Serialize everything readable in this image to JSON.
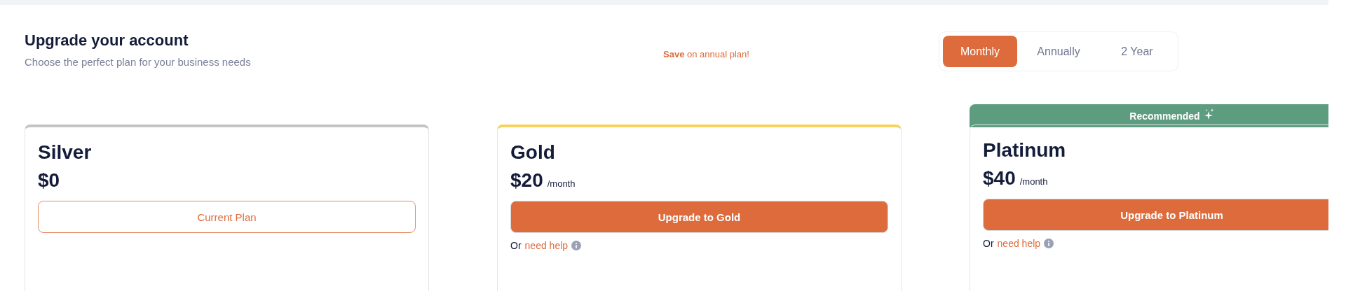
{
  "header": {
    "title": "Upgrade your account",
    "subtitle": "Choose the perfect plan for your business needs"
  },
  "promo": "**Save** on annual plan!",
  "billing_tabs": [
    {
      "label": "Monthly",
      "selected": true
    },
    {
      "label": "Annually",
      "selected": false
    },
    {
      "label": "2 Year",
      "selected": false
    }
  ],
  "plans": [
    {
      "name": "Silver",
      "price": "$0",
      "color": "#c4c4c4",
      "button": {
        "label": "Current Plan",
        "kind": "outline"
      }
    },
    {
      "name": "Gold",
      "price": "$20",
      "period": "/month",
      "color": "#f4d35e",
      "button": {
        "label": "Upgrade to Gold",
        "kind": "filled"
      },
      "help": {
        "prefix": "Or",
        "link": "need help"
      }
    },
    {
      "name": "Platinum",
      "price": "$40",
      "period": "/month",
      "color": "#5e9c80",
      "banner": "Recommended",
      "button": {
        "label": "Upgrade to Platinum",
        "kind": "filled"
      },
      "help": {
        "prefix": "Or",
        "link": "need help"
      }
    }
  ]
}
